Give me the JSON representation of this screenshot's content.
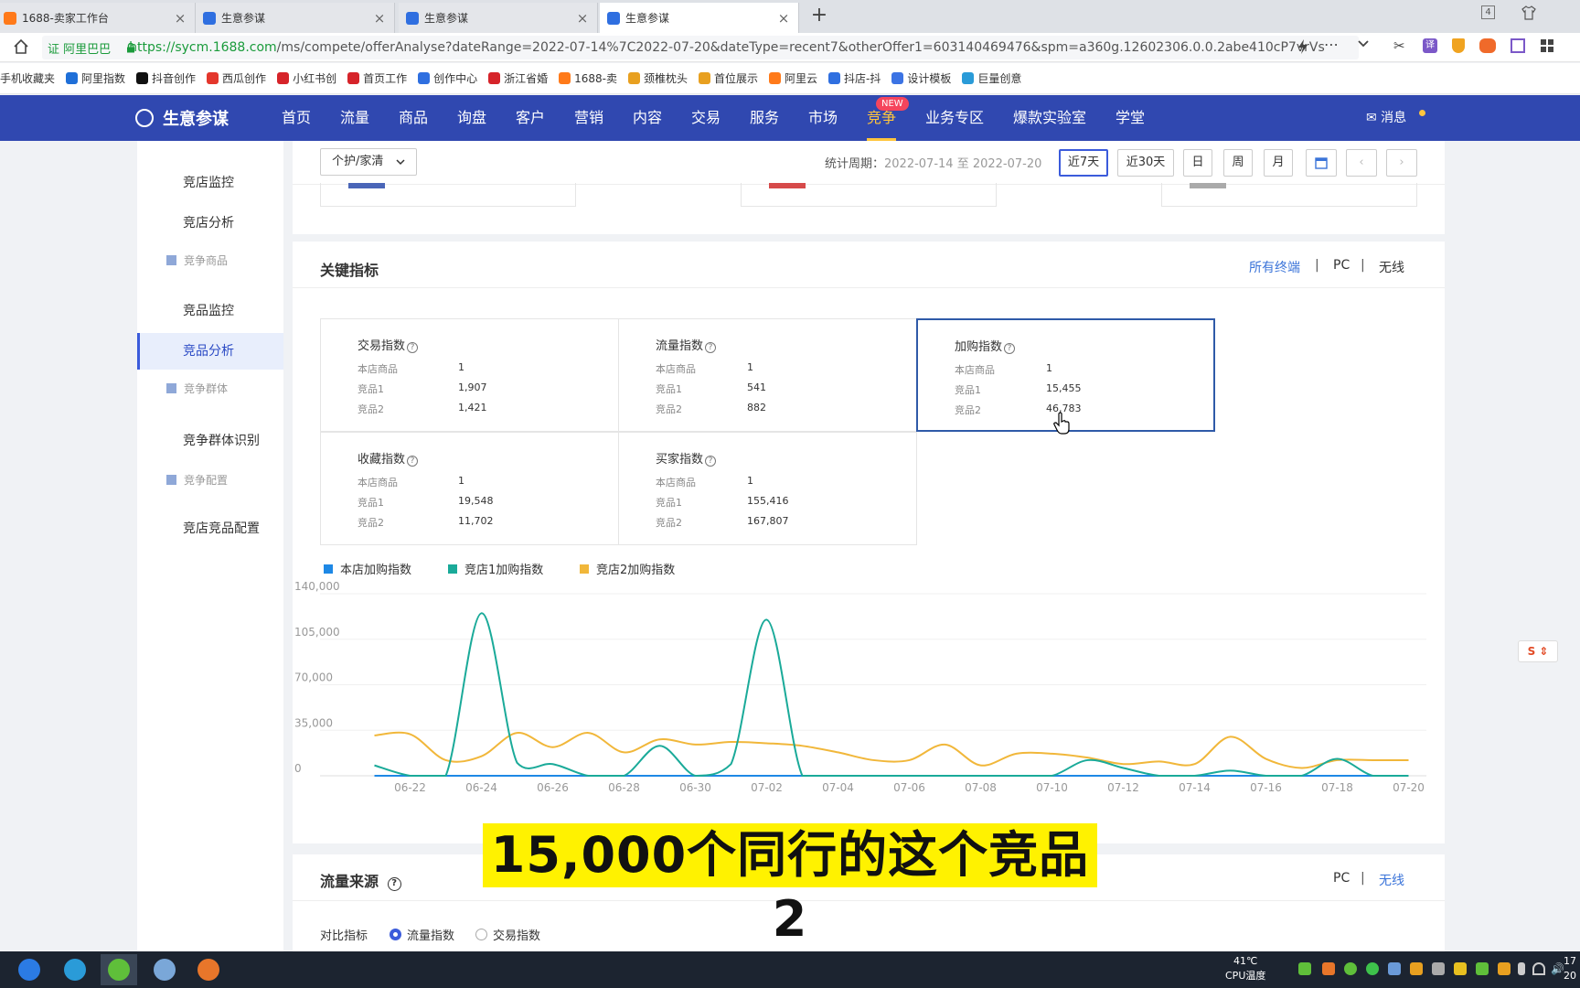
{
  "browser": {
    "tabs": [
      {
        "label": "1688-卖家工作台",
        "color": "#ff7a1a"
      },
      {
        "label": "生意参谋",
        "color": "#2f6fe0"
      },
      {
        "label": "生意参谋",
        "color": "#2f6fe0"
      },
      {
        "label": "生意参谋",
        "color": "#2f6fe0"
      }
    ],
    "tab_close": "×",
    "new_tab": "+",
    "window_count": "4",
    "cert_label": "证 阿里巴巴",
    "url_secure": "https://",
    "url_host": "sycm.1688.com",
    "url_path": "/ms/compete/offerAnalyse?dateRange=2022-07-14%7C2022-07-20&dateType=recent7&otherOffer1=603140469476&spm=a360g.12602306.0.0.2abe410cP7vrVs",
    "bookmarks": [
      "手机收藏夹",
      "阿里指数",
      "抖音创作",
      "西瓜创作",
      "小红书创",
      "首页工作",
      "创作中心",
      "浙江省婚",
      "1688-卖",
      "颈椎枕头",
      "首位展示",
      "阿里云",
      "抖店-抖",
      "设计模板",
      "巨量创意"
    ],
    "bookmark_colors": [
      "#1f6fd8",
      "#111111",
      "#e4372c",
      "#d6242a",
      "#d6242a",
      "#2f6fe0",
      "#d6242a",
      "#ff7a1a",
      "#e8a020",
      "#e8a020",
      "#ff7a1a",
      "#2f6fe0",
      "#3b73e4",
      "#2a9bd8"
    ]
  },
  "app": {
    "logo": "生意参谋",
    "nav": [
      "首页",
      "流量",
      "商品",
      "询盘",
      "客户",
      "营销",
      "内容",
      "交易",
      "服务",
      "市场",
      "竞争",
      "业务专区",
      "爆款实验室",
      "学堂"
    ],
    "active_nav": "竞争",
    "new_badge": "NEW",
    "message": "✉ 消息",
    "accent": "#3048b0"
  },
  "sidebar": {
    "items": [
      {
        "label": "竞店监控",
        "type": "item"
      },
      {
        "label": "竞店分析",
        "type": "item"
      },
      {
        "label": "竞争商品",
        "type": "group"
      },
      {
        "label": "竞品监控",
        "type": "item"
      },
      {
        "label": "竞品分析",
        "type": "item",
        "active": true
      },
      {
        "label": "竞争群体",
        "type": "group"
      },
      {
        "label": "竞争群体识别",
        "type": "item"
      },
      {
        "label": "竞争配置",
        "type": "group"
      },
      {
        "label": "竞店竞品配置",
        "type": "item"
      }
    ]
  },
  "filters": {
    "category": "个护/家清",
    "period_label": "统计周期：",
    "period_value": "2022-07-14 至 2022-07-20",
    "buttons": [
      "近7天",
      "近30天",
      "日",
      "周",
      "月"
    ],
    "active_button": "近7天"
  },
  "kpi": {
    "title": "关键指标",
    "terminals": [
      "所有终端",
      "PC",
      "无线"
    ],
    "separator": "|",
    "row_labels": [
      "本店商品",
      "竞品1",
      "竞品2"
    ],
    "help": "?",
    "metrics": [
      {
        "title": "交易指数",
        "values": [
          "1",
          "1,907",
          "1,421"
        ]
      },
      {
        "title": "流量指数",
        "values": [
          "1",
          "541",
          "882"
        ]
      },
      {
        "title": "加购指数",
        "values": [
          "1",
          "15,455",
          "46,783"
        ],
        "active": true
      },
      {
        "title": "收藏指数",
        "values": [
          "1",
          "19,548",
          "11,702"
        ]
      },
      {
        "title": "买家指数",
        "values": [
          "1",
          "155,416",
          "167,807"
        ]
      }
    ]
  },
  "chart_data": {
    "type": "line",
    "x": [
      "06-21",
      "06-22",
      "06-23",
      "06-24",
      "06-25",
      "06-26",
      "06-27",
      "06-28",
      "06-29",
      "06-30",
      "07-01",
      "07-02",
      "07-03",
      "07-04",
      "07-05",
      "07-06",
      "07-07",
      "07-08",
      "07-09",
      "07-10",
      "07-11",
      "07-12",
      "07-13",
      "07-14",
      "07-15",
      "07-16",
      "07-17",
      "07-18",
      "07-19",
      "07-20"
    ],
    "xticks": [
      "06-22",
      "06-24",
      "06-26",
      "06-28",
      "06-30",
      "07-02",
      "07-04",
      "07-06",
      "07-08",
      "07-10",
      "07-12",
      "07-14",
      "07-16",
      "07-18",
      "07-20"
    ],
    "yticks": [
      "0",
      "35,000",
      "70,000",
      "105,000",
      "140,000"
    ],
    "ylim": [
      0,
      140000
    ],
    "series": [
      {
        "name": "本店加购指数",
        "color": "#1e88e5",
        "values": [
          1,
          1,
          1,
          1,
          1,
          1,
          1,
          1,
          1,
          1,
          1,
          1,
          1,
          1,
          1,
          1,
          1,
          1,
          1,
          1,
          1,
          1,
          1,
          1,
          1,
          1,
          1,
          1,
          1,
          1
        ]
      },
      {
        "name": "竞店1加购指数",
        "color": "#1aaa99",
        "values": [
          8000,
          0,
          0,
          125000,
          10000,
          9000,
          0,
          0,
          23000,
          0,
          9000,
          120000,
          0,
          0,
          0,
          0,
          0,
          0,
          0,
          0,
          12000,
          6000,
          0,
          0,
          4000,
          0,
          0,
          13000,
          0,
          0
        ]
      },
      {
        "name": "竞店2加购指数",
        "color": "#f1b73a",
        "values": [
          31000,
          32000,
          12000,
          15000,
          33000,
          22000,
          33000,
          18000,
          28000,
          24000,
          26000,
          25000,
          23000,
          18000,
          12000,
          12000,
          24000,
          8000,
          17000,
          17000,
          14000,
          9000,
          11000,
          9000,
          30000,
          13000,
          6000,
          12000,
          12000,
          12000
        ]
      }
    ]
  },
  "traffic": {
    "title": "流量来源",
    "terminals": [
      "PC",
      "无线"
    ],
    "separator": "|",
    "compare_label": "对比指标",
    "options": [
      "流量指数",
      "交易指数"
    ],
    "selected": "流量指数",
    "help": "?"
  },
  "subtitle": "15,000个同行的这个竞品2",
  "widget_s5": "S ⇕",
  "taskbar": {
    "apps": [
      {
        "name": "qq-browser",
        "color": "#2b7be4"
      },
      {
        "name": "ie-browser",
        "color": "#2a9bd8"
      },
      {
        "name": "360-browser",
        "color": "#5fbf3a"
      },
      {
        "name": "notes-app",
        "color": "#7aa7d8"
      },
      {
        "name": "tiger-app",
        "color": "#e8762a"
      }
    ],
    "temp": "41℃",
    "temp_label": "CPU温度",
    "clock_1": "17",
    "clock_2": "20"
  }
}
